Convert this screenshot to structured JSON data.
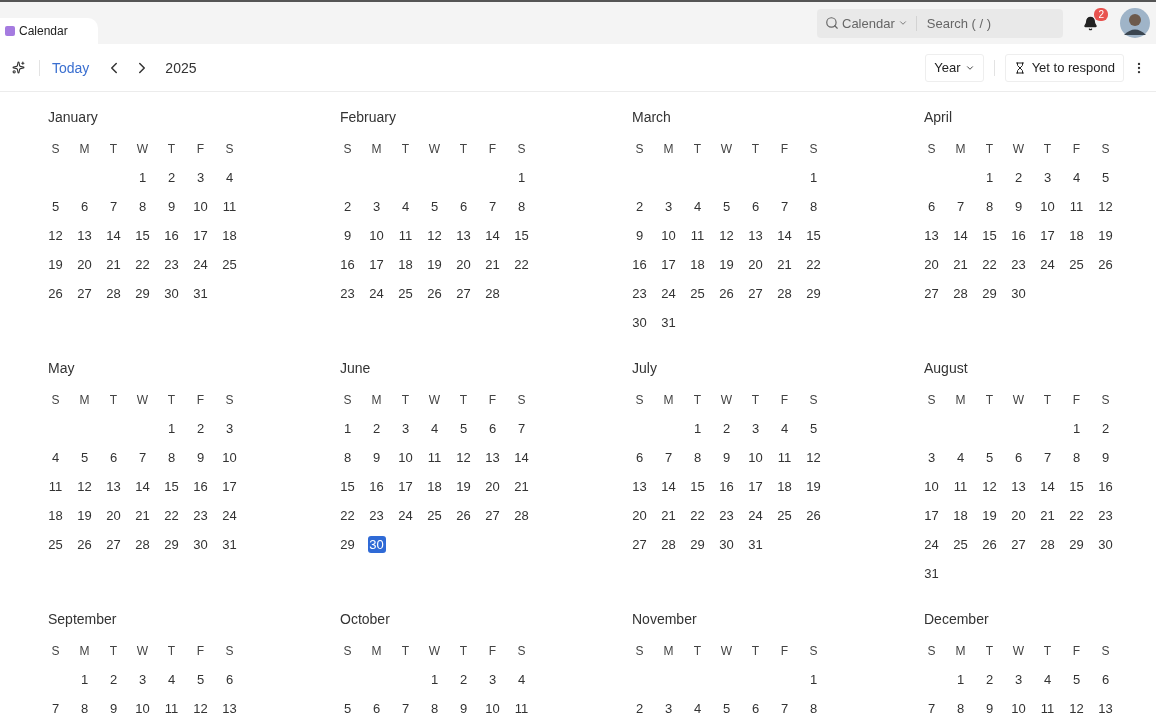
{
  "app_tab": {
    "label": "Calendar",
    "selected": true
  },
  "search": {
    "scope": "Calendar",
    "placeholder": "Search ( / )"
  },
  "notifications": {
    "count": "2"
  },
  "toolbar": {
    "today": "Today",
    "year": "2025",
    "view": "Year",
    "filter": "Yet to respond"
  },
  "months": [
    {
      "name": "January",
      "weekdays": [
        "S",
        "M",
        "T",
        "W",
        "T",
        "F",
        "S"
      ],
      "weeks": [
        [
          "1",
          "2",
          "3",
          "4"
        ],
        [
          "5",
          "6",
          "7",
          "8",
          "9",
          "10",
          "11"
        ],
        [
          "12",
          "13",
          "14",
          "15",
          "16",
          "17",
          "18"
        ],
        [
          "19",
          "20",
          "21",
          "22",
          "23",
          "24",
          "25"
        ],
        [
          "26",
          "27",
          "28",
          "29",
          "30",
          "31"
        ]
      ]
    },
    {
      "name": "February",
      "weekdays": [
        "S",
        "M",
        "T",
        "W",
        "T",
        "F",
        "S"
      ],
      "weeks": [
        [
          "1"
        ],
        [
          "2",
          "3",
          "4",
          "5",
          "6",
          "7",
          "8"
        ],
        [
          "9",
          "10",
          "11",
          "12",
          "13",
          "14",
          "15"
        ],
        [
          "16",
          "17",
          "18",
          "19",
          "20",
          "21",
          "22"
        ],
        [
          "23",
          "24",
          "25",
          "26",
          "27",
          "28"
        ]
      ]
    },
    {
      "name": "March",
      "weekdays": [
        "S",
        "M",
        "T",
        "W",
        "T",
        "F",
        "S"
      ],
      "weeks": [
        [
          "1"
        ],
        [
          "2",
          "3",
          "4",
          "5",
          "6",
          "7",
          "8"
        ],
        [
          "9",
          "10",
          "11",
          "12",
          "13",
          "14",
          "15"
        ],
        [
          "16",
          "17",
          "18",
          "19",
          "20",
          "21",
          "22"
        ],
        [
          "23",
          "24",
          "25",
          "26",
          "27",
          "28",
          "29"
        ],
        [
          "30",
          "31"
        ]
      ]
    },
    {
      "name": "April",
      "weekdays": [
        "S",
        "M",
        "T",
        "W",
        "T",
        "F",
        "S"
      ],
      "weeks": [
        [
          "1",
          "2",
          "3",
          "4",
          "5"
        ],
        [
          "6",
          "7",
          "8",
          "9",
          "10",
          "11",
          "12"
        ],
        [
          "13",
          "14",
          "15",
          "16",
          "17",
          "18",
          "19"
        ],
        [
          "20",
          "21",
          "22",
          "23",
          "24",
          "25",
          "26"
        ],
        [
          "27",
          "28",
          "29",
          "30"
        ]
      ]
    },
    {
      "name": "May",
      "weekdays": [
        "S",
        "M",
        "T",
        "W",
        "T",
        "F",
        "S"
      ],
      "weeks": [
        [
          "1",
          "2",
          "3"
        ],
        [
          "4",
          "5",
          "6",
          "7",
          "8",
          "9",
          "10"
        ],
        [
          "11",
          "12",
          "13",
          "14",
          "15",
          "16",
          "17"
        ],
        [
          "18",
          "19",
          "20",
          "21",
          "22",
          "23",
          "24"
        ],
        [
          "25",
          "26",
          "27",
          "28",
          "29",
          "30",
          "31"
        ]
      ]
    },
    {
      "name": "June",
      "weekdays": [
        "S",
        "M",
        "T",
        "W",
        "T",
        "F",
        "S"
      ],
      "weeks": [
        [
          "1",
          "2",
          "3",
          "4",
          "5",
          "6",
          "7"
        ],
        [
          "8",
          "9",
          "10",
          "11",
          "12",
          "13",
          "14"
        ],
        [
          "15",
          "16",
          "17",
          "18",
          "19",
          "20",
          "21"
        ],
        [
          "22",
          "23",
          "24",
          "25",
          "26",
          "27",
          "28"
        ],
        [
          "29",
          {
            "label": "30",
            "selected": true
          }
        ]
      ]
    },
    {
      "name": "July",
      "weekdays": [
        "S",
        "M",
        "T",
        "W",
        "T",
        "F",
        "S"
      ],
      "weeks": [
        [
          "1",
          "2",
          "3",
          "4",
          "5"
        ],
        [
          "6",
          "7",
          "8",
          "9",
          "10",
          "11",
          "12"
        ],
        [
          "13",
          "14",
          "15",
          "16",
          "17",
          "18",
          "19"
        ],
        [
          "20",
          "21",
          "22",
          "23",
          "24",
          "25",
          "26"
        ],
        [
          "27",
          "28",
          "29",
          "30",
          "31"
        ]
      ]
    },
    {
      "name": "August",
      "weekdays": [
        "S",
        "M",
        "T",
        "W",
        "T",
        "F",
        "S"
      ],
      "weeks": [
        [
          "1",
          "2"
        ],
        [
          "3",
          "4",
          "5",
          "6",
          "7",
          "8",
          "9"
        ],
        [
          "10",
          "11",
          "12",
          "13",
          "14",
          "15",
          "16"
        ],
        [
          "17",
          "18",
          "19",
          "20",
          "21",
          "22",
          "23"
        ],
        [
          "24",
          "25",
          "26",
          "27",
          "28",
          "29",
          "30"
        ],
        [
          "31"
        ]
      ]
    },
    {
      "name": "September",
      "weekdays": [
        "S",
        "M",
        "T",
        "W",
        "T",
        "F",
        "S"
      ],
      "weeks": [
        [
          "1",
          "2",
          "3",
          "4",
          "5",
          "6"
        ],
        [
          "7",
          "8",
          "9",
          "10",
          "11",
          "12",
          "13"
        ]
      ]
    },
    {
      "name": "October",
      "weekdays": [
        "S",
        "M",
        "T",
        "W",
        "T",
        "F",
        "S"
      ],
      "weeks": [
        [
          "1",
          "2",
          "3",
          "4"
        ],
        [
          "5",
          "6",
          "7",
          "8",
          "9",
          "10",
          "11"
        ]
      ]
    },
    {
      "name": "November",
      "weekdays": [
        "S",
        "M",
        "T",
        "W",
        "T",
        "F",
        "S"
      ],
      "weeks": [
        [
          "1"
        ],
        [
          "2",
          "3",
          "4",
          "5",
          "6",
          "7",
          "8"
        ]
      ]
    },
    {
      "name": "December",
      "weekdays": [
        "S",
        "M",
        "T",
        "W",
        "T",
        "F",
        "S"
      ],
      "weeks": [
        [
          "1",
          "2",
          "3",
          "4",
          "5",
          "6"
        ],
        [
          "7",
          "8",
          "9",
          "10",
          "11",
          "12",
          "13"
        ]
      ]
    }
  ]
}
